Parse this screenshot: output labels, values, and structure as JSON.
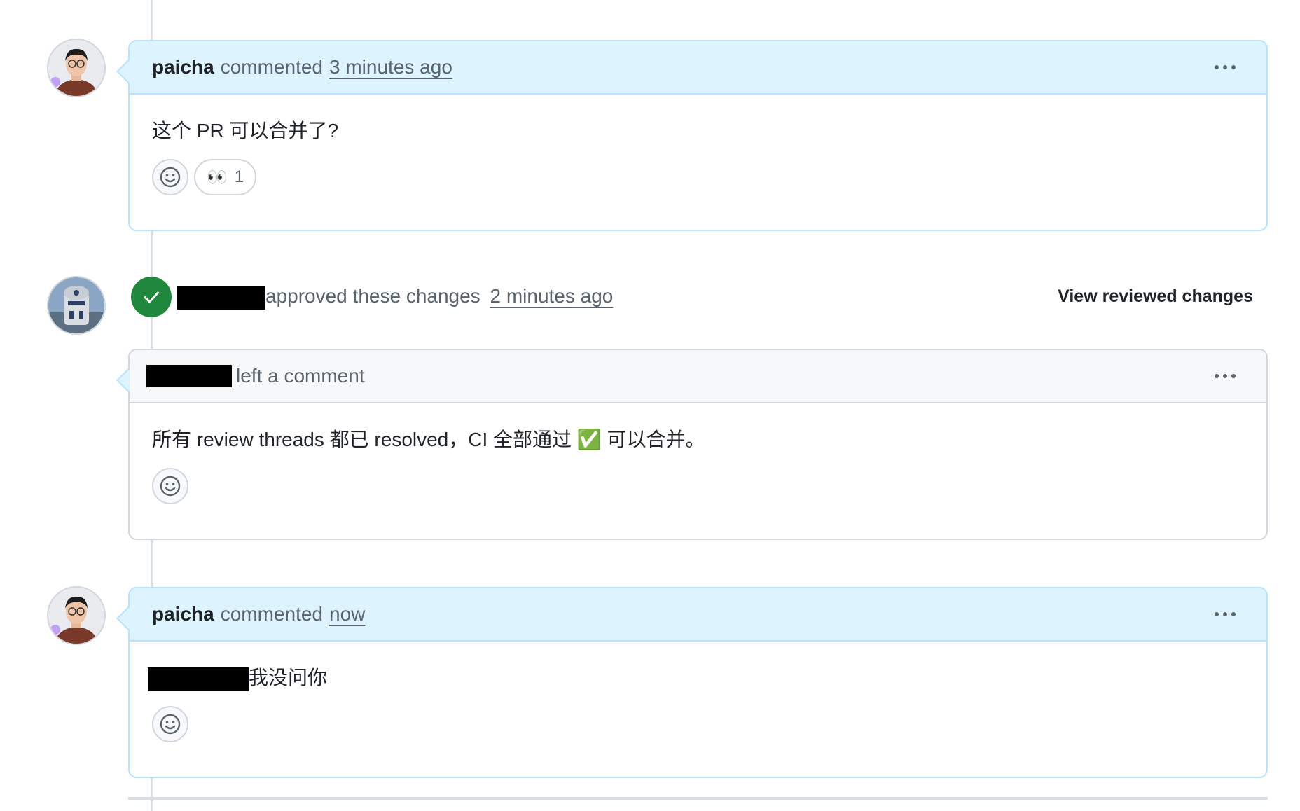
{
  "comments": [
    {
      "author": "paicha",
      "action": "commented",
      "time": "3 minutes ago",
      "body": "这个 PR 可以合并了?",
      "reactions": [
        {
          "emoji": "👀",
          "count": "1"
        }
      ]
    },
    {
      "action": "left a comment",
      "body": "所有 review threads 都已 resolved，CI 全部通过 ✅ 可以合并。"
    },
    {
      "author": "paicha",
      "action": "commented",
      "time": "now",
      "body": "我没问你"
    }
  ],
  "review": {
    "action": "approved these changes",
    "time": "2 minutes ago",
    "view_changes_label": "View reviewed changes"
  },
  "icons": {
    "kebab": "kebab-horizontal-icon",
    "smiley": "smiley-icon",
    "approve": "check-icon"
  },
  "colors": {
    "comment_header_bg": "#ddf4ff",
    "comment_border": "#b6e3ff",
    "approve_green": "#1f883d",
    "muted_text": "#59636e"
  }
}
